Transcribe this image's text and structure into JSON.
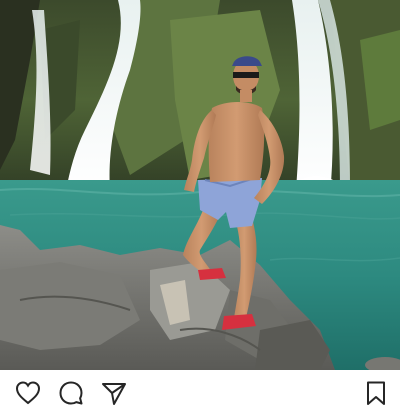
{
  "post": {
    "photo_alt": "",
    "actions": {
      "like_icon": "heart-icon",
      "comment_icon": "comment-bubble-icon",
      "share_icon": "paper-plane-icon",
      "save_icon": "bookmark-icon"
    }
  },
  "colors": {
    "icon_stroke": "#262626",
    "water": "#2f8f86",
    "background": "#ffffff"
  }
}
